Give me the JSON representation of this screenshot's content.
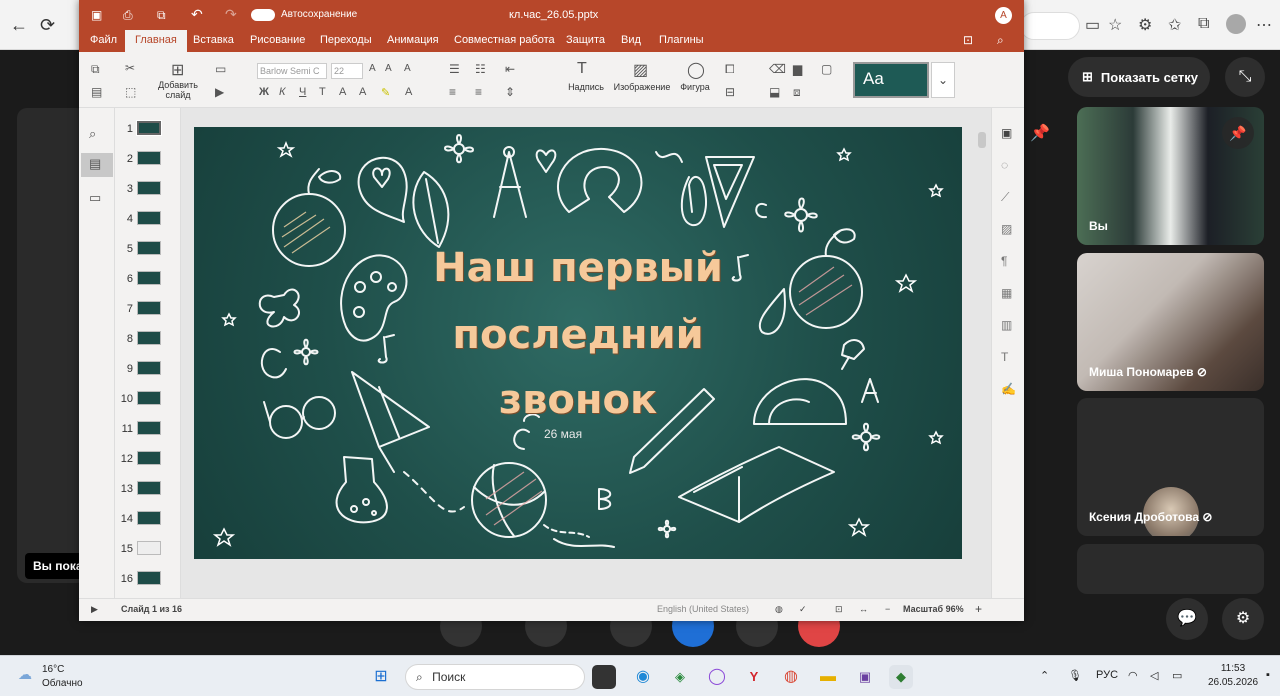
{
  "browser": {
    "nav": [
      "←",
      "⟳"
    ],
    "icons": [
      "video-icon",
      "star-icon",
      "extensions-icon",
      "favorites-icon",
      "profile-icon",
      "more-icon"
    ]
  },
  "meeting": {
    "grid_button": "Показать сетку",
    "share_label": "Вы пока",
    "participants": [
      {
        "name": "Вы"
      },
      {
        "name": "Миша Пономарев"
      },
      {
        "name": "Ксения Дроботова"
      }
    ]
  },
  "ppt": {
    "autosave_label": "Автосохранение",
    "filename": "кл.час_26.05.pptx",
    "user_initial": "A",
    "tabs": [
      "Файл",
      "Главная",
      "Вставка",
      "Рисование",
      "Переходы",
      "Анимация",
      "Совместная работа",
      "Защита",
      "Вид",
      "Плагины"
    ],
    "ribbon": {
      "add_slide": "Добавить",
      "add_slide2": "слайд",
      "font_name": "Barlow Semi C",
      "font_size": "22",
      "caption": "Надпись",
      "image": "Изображение",
      "figure": "Фигура",
      "theme_sample": "Aa"
    },
    "slide_numbers": [
      "1",
      "2",
      "3",
      "4",
      "5",
      "6",
      "7",
      "8",
      "9",
      "10",
      "11",
      "12",
      "13",
      "14",
      "15",
      "16"
    ],
    "slide": {
      "title_line1": "Наш первый",
      "title_line2": "последний",
      "title_line3": "звонок",
      "date": "26 мая"
    },
    "status": {
      "slide_counter": "Слайд 1 из 16",
      "language": "English (United States)",
      "zoom": "Масштаб 96%"
    }
  },
  "taskbar": {
    "temp": "16°C",
    "weather": "Облачно",
    "search": "Поиск",
    "lang": "РУС",
    "time": "11:53",
    "date": "26.05.2026"
  }
}
